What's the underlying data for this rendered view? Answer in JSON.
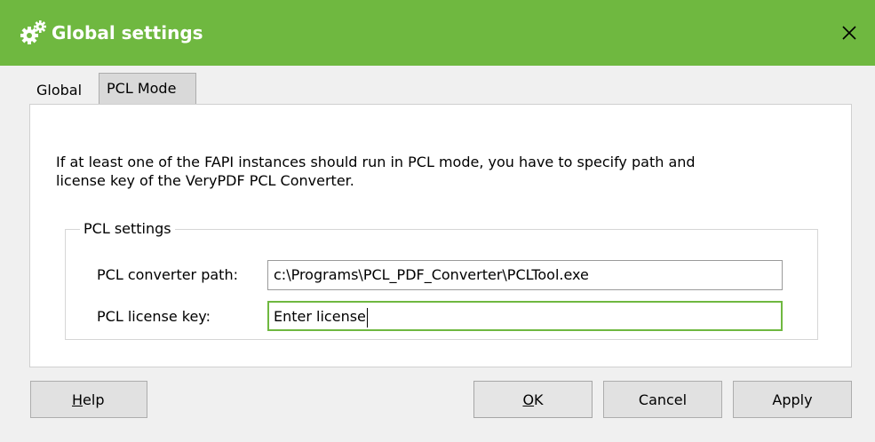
{
  "window": {
    "title": "Global settings",
    "accent_color": "#6fb840",
    "icon": "gears-icon"
  },
  "tabs": [
    {
      "label": "Global",
      "selected": false
    },
    {
      "label": "PCL Mode",
      "selected": true
    }
  ],
  "panel": {
    "info_line1": "If at least one of the FAPI instances should run in PCL mode, you have to specify path and",
    "info_line2": "license key of the VeryPDF PCL Converter.",
    "group_title": "PCL settings",
    "fields": {
      "converter_path": {
        "label": "PCL converter path:",
        "value": "c:\\Programs\\PCL_PDF_Converter\\PCLTool.exe"
      },
      "license_key": {
        "label": "PCL license key:",
        "value": "Enter license"
      }
    }
  },
  "buttons": {
    "help": {
      "mnemonic": "H",
      "rest": "elp"
    },
    "ok": {
      "mnemonic": "O",
      "rest": "K"
    },
    "cancel": "Cancel",
    "apply": "Apply"
  }
}
